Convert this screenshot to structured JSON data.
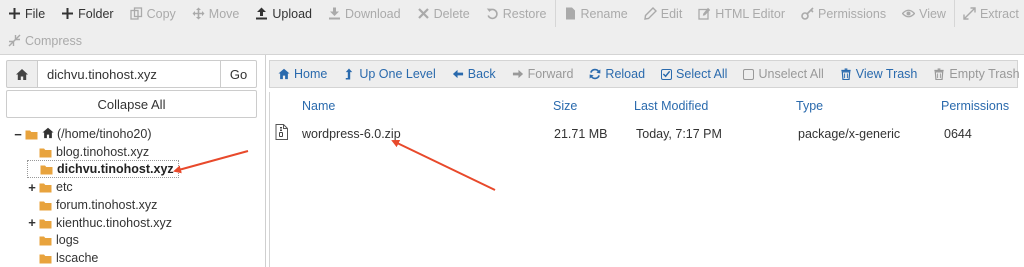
{
  "toolbar": {
    "row1": [
      {
        "label": "File",
        "icon": "plus-icon",
        "disabled": false
      },
      {
        "label": "Folder",
        "icon": "plus-icon",
        "disabled": false
      },
      {
        "label": "Copy",
        "icon": "copy-icon",
        "disabled": true
      },
      {
        "label": "Move",
        "icon": "move-icon",
        "disabled": true
      },
      {
        "label": "Upload",
        "icon": "upload-icon",
        "disabled": false
      },
      {
        "label": "Download",
        "icon": "download-icon",
        "disabled": true
      },
      {
        "label": "Delete",
        "icon": "close-icon",
        "disabled": true
      },
      {
        "label": "Restore",
        "icon": "restore-icon",
        "disabled": true
      },
      {
        "label": "Rename",
        "icon": "file-icon",
        "disabled": true
      },
      {
        "label": "Edit",
        "icon": "pencil-icon",
        "disabled": true
      },
      {
        "label": "HTML Editor",
        "icon": "edit-square-icon",
        "disabled": true
      },
      {
        "label": "Permissions",
        "icon": "key-icon",
        "disabled": true
      },
      {
        "label": "View",
        "icon": "eye-icon",
        "disabled": true
      },
      {
        "label": "Extract",
        "icon": "expand-icon",
        "disabled": true
      }
    ],
    "row2": [
      {
        "label": "Compress",
        "icon": "compress-icon",
        "disabled": true
      }
    ]
  },
  "left": {
    "path_value": "dichvu.tinohost.xyz",
    "go_label": "Go",
    "collapse_label": "Collapse All",
    "tree": [
      {
        "label": "(/home/tinoho20)",
        "level": 0,
        "toggle": "−",
        "home": true
      },
      {
        "label": "blog.tinohost.xyz",
        "level": 1,
        "toggle": ""
      },
      {
        "label": "dichvu.tinohost.xyz",
        "level": 1,
        "toggle": "",
        "selected": true
      },
      {
        "label": "etc",
        "level": 1,
        "toggle": "+"
      },
      {
        "label": "forum.tinohost.xyz",
        "level": 1,
        "toggle": ""
      },
      {
        "label": "kienthuc.tinohost.xyz",
        "level": 1,
        "toggle": "+"
      },
      {
        "label": "logs",
        "level": 1,
        "toggle": ""
      },
      {
        "label": "lscache",
        "level": 1,
        "toggle": ""
      }
    ]
  },
  "actions": [
    {
      "label": "Home",
      "icon": "home-icon",
      "disabled": false
    },
    {
      "label": "Up One Level",
      "icon": "level-up-icon",
      "disabled": false
    },
    {
      "label": "Back",
      "icon": "arrow-left-icon",
      "disabled": false
    },
    {
      "label": "Forward",
      "icon": "arrow-right-icon",
      "disabled": true
    },
    {
      "label": "Reload",
      "icon": "reload-icon",
      "disabled": false
    },
    {
      "label": "Select All",
      "icon": "checkbox-checked-icon",
      "disabled": false
    },
    {
      "label": "Unselect All",
      "icon": "checkbox-empty-icon",
      "disabled": true
    },
    {
      "label": "View Trash",
      "icon": "trash-icon",
      "disabled": false
    },
    {
      "label": "Empty Trash",
      "icon": "trash-icon",
      "disabled": true
    }
  ],
  "table": {
    "columns": [
      "Name",
      "Size",
      "Last Modified",
      "Type",
      "Permissions"
    ],
    "rows": [
      {
        "name": "wordpress-6.0.zip",
        "size": "21.71 MB",
        "modified": "Today, 7:17 PM",
        "type": "package/x-generic",
        "perms": "0644",
        "icon": "zip-file-icon"
      }
    ]
  },
  "colors": {
    "accent": "#2a6aad",
    "toolbar_bg": "#eeeeee",
    "arrow": "#e8492b",
    "folder": "#e8a33d"
  }
}
